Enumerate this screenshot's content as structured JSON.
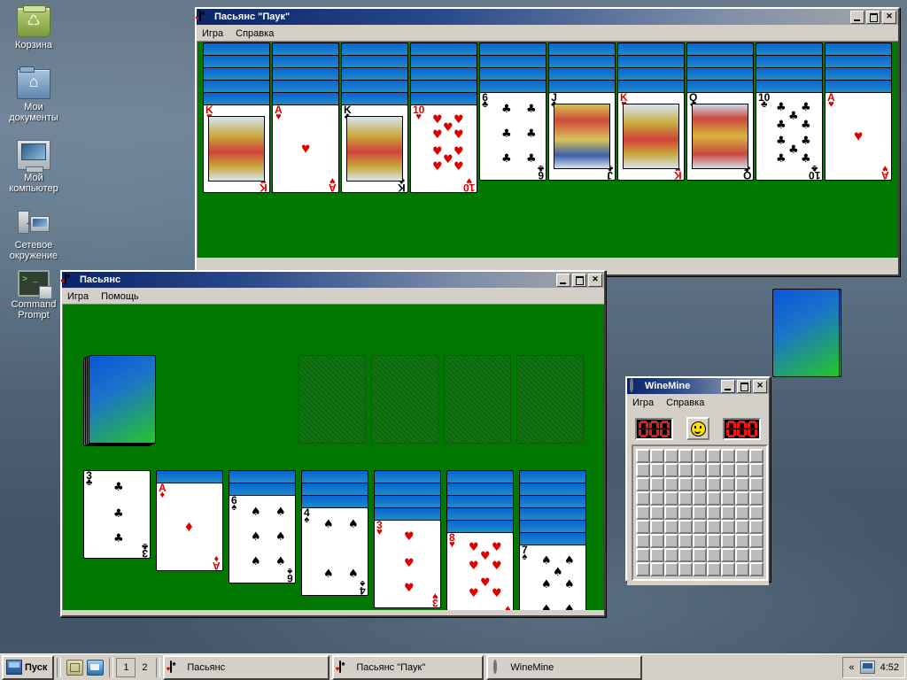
{
  "desktop": {
    "icons": [
      {
        "name": "recycle-bin",
        "label": "Корзина"
      },
      {
        "name": "my-documents",
        "label": "Мои\nдокументы"
      },
      {
        "name": "my-computer",
        "label": "Мой\nкомпьютер"
      },
      {
        "name": "network-neighborhood",
        "label": "Сетевое\nокружение"
      },
      {
        "name": "command-prompt",
        "label": "Command\nPrompt"
      }
    ]
  },
  "spider_window": {
    "title": "Пасьянс \"Паук\"",
    "icon": "spider-cards-icon",
    "menu": [
      "Игра",
      "Справка"
    ],
    "buttons": {
      "minimize": "_",
      "maximize": "□",
      "close": "✕"
    },
    "table_felt_color": "#007800",
    "columns": [
      {
        "facedown": 5,
        "card": {
          "rank": "K",
          "suit": "♥",
          "color": "red",
          "kind": "court"
        }
      },
      {
        "facedown": 5,
        "card": {
          "rank": "A",
          "suit": "♥",
          "color": "red",
          "kind": "ace"
        }
      },
      {
        "facedown": 5,
        "card": {
          "rank": "K",
          "suit": "♣",
          "color": "black",
          "kind": "court"
        }
      },
      {
        "facedown": 5,
        "card": {
          "rank": "10",
          "suit": "♥",
          "color": "red",
          "kind": "number"
        }
      },
      {
        "facedown": 4,
        "card": {
          "rank": "6",
          "suit": "♣",
          "color": "black",
          "kind": "number"
        }
      },
      {
        "facedown": 4,
        "card": {
          "rank": "J",
          "suit": "♣",
          "color": "black",
          "kind": "court"
        }
      },
      {
        "facedown": 4,
        "card": {
          "rank": "K",
          "suit": "♥",
          "color": "red",
          "kind": "court"
        }
      },
      {
        "facedown": 4,
        "card": {
          "rank": "Q",
          "suit": "♣",
          "color": "black",
          "kind": "court"
        }
      },
      {
        "facedown": 4,
        "card": {
          "rank": "10",
          "suit": "♣",
          "color": "black",
          "kind": "number"
        }
      },
      {
        "facedown": 4,
        "card": {
          "rank": "A",
          "suit": "♥",
          "color": "red",
          "kind": "ace"
        }
      }
    ],
    "stock_piles": 5
  },
  "klondike_window": {
    "title": "Пасьянс",
    "icon": "cards-icon",
    "menu": [
      "Игра",
      "Помощь"
    ],
    "buttons": {
      "minimize": "_",
      "maximize": "□",
      "close": "✕"
    },
    "stock_label": "stock-pile",
    "foundations": 4,
    "columns": [
      {
        "facedown": 0,
        "card": {
          "rank": "3",
          "suit": "♣",
          "color": "black",
          "kind": "number"
        }
      },
      {
        "facedown": 1,
        "card": {
          "rank": "A",
          "suit": "♦",
          "color": "red",
          "kind": "ace"
        }
      },
      {
        "facedown": 2,
        "card": {
          "rank": "6",
          "suit": "♠",
          "color": "black",
          "kind": "number"
        }
      },
      {
        "facedown": 3,
        "card": {
          "rank": "4",
          "suit": "♠",
          "color": "black",
          "kind": "number"
        }
      },
      {
        "facedown": 4,
        "card": {
          "rank": "3",
          "suit": "♥",
          "color": "red",
          "kind": "number"
        }
      },
      {
        "facedown": 5,
        "card": {
          "rank": "8",
          "suit": "♥",
          "color": "red",
          "kind": "number"
        }
      },
      {
        "facedown": 6,
        "card": {
          "rank": "7",
          "suit": "♠",
          "color": "black",
          "kind": "number"
        }
      }
    ]
  },
  "winemine_window": {
    "title": "WineMine",
    "icon": "mine-gear-icon",
    "menu": [
      "Игра",
      "Справка"
    ],
    "buttons": {
      "minimize": "_",
      "maximize": "□",
      "close": "✕"
    },
    "mines_counter": "000",
    "timer_counter": "000",
    "face": "smiley-face",
    "grid": {
      "cols": 9,
      "rows": 9
    }
  },
  "taskbar": {
    "start_label": "Пуск",
    "quick_launch": [
      "show-desktop-icon",
      "browser-icon"
    ],
    "pager": [
      "1",
      "2"
    ],
    "pager_selected": "1",
    "tasks": [
      {
        "label": "Пасьянс",
        "icon": "cards-icon"
      },
      {
        "label": "Пасьянс \"Паук\"",
        "icon": "spider-cards-icon"
      },
      {
        "label": "WineMine",
        "icon": "mine-gear-icon"
      }
    ],
    "tray": {
      "expand": "«",
      "network_icon": "network-tray-icon",
      "clock": "4:52"
    }
  }
}
